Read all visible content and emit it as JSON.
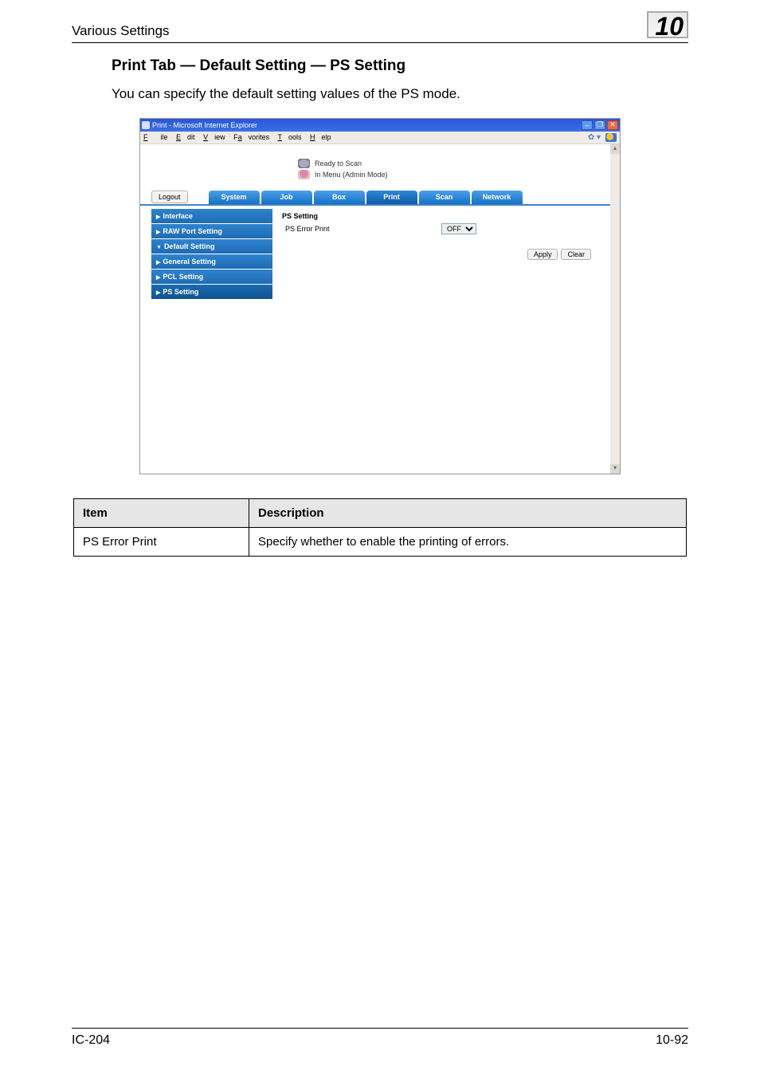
{
  "header": {
    "breadcrumb": "Various Settings",
    "chapter": "10"
  },
  "section": {
    "heading": "Print Tab — Default Setting — PS Setting",
    "body": "You can specify the default setting values of the PS mode."
  },
  "screenshot": {
    "window_title": "Print - Microsoft Internet Explorer",
    "menubar": {
      "file": "File",
      "edit": "Edit",
      "view": "View",
      "favorites": "Favorites",
      "tools": "Tools",
      "help": "Help"
    },
    "status1": "Ready to Scan",
    "status2": "In Menu (Admin Mode)",
    "logout": "Logout",
    "tabs": {
      "system": "System",
      "job": "Job",
      "box": "Box",
      "print": "Print",
      "scan": "Scan",
      "network": "Network"
    },
    "sidebar": {
      "interface": "Interface",
      "raw_port": "RAW Port Setting",
      "default_setting": "Default Setting",
      "general": "General Setting",
      "pcl": "PCL Setting",
      "ps": "PS Setting"
    },
    "panel": {
      "title": "PS Setting",
      "row_label": "PS Error Print",
      "row_value": "OFF",
      "apply": "Apply",
      "clear": "Clear"
    }
  },
  "table": {
    "headers": {
      "item": "Item",
      "desc": "Description"
    },
    "rows": [
      {
        "item": "PS Error Print",
        "desc": "Specify whether to enable the printing of errors."
      }
    ]
  },
  "footer": {
    "left": "IC-204",
    "right": "10-92"
  }
}
